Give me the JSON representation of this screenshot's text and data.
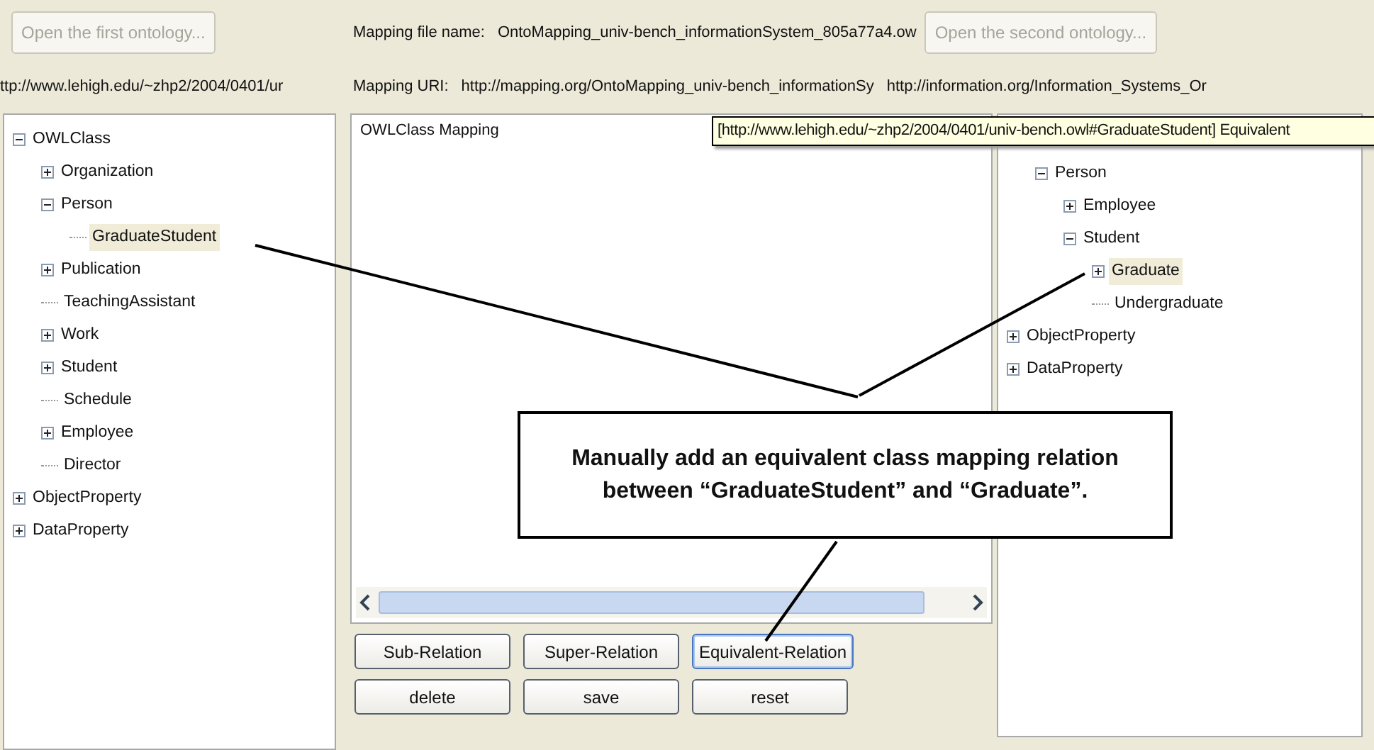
{
  "top_bar": {
    "open_first_button": {
      "label": "Open the first ontology...",
      "disabled": true
    },
    "mapping_file_label": "Mapping file name:",
    "mapping_file_name": "OntoMapping_univ-bench_informationSystem_805a77a4.ow",
    "open_second_button": {
      "label": "Open the second ontology...",
      "disabled": true
    }
  },
  "uri_bar": {
    "first_ontology_uri": "ttp://www.lehigh.edu/~zhp2/2004/0401/ur",
    "mapping_uri_label": "Mapping URI:",
    "mapping_uri": "http://mapping.org/OntoMapping_univ-bench_informationSy",
    "second_ontology_uri": "http://information.org/Information_Systems_Or"
  },
  "left_tree": [
    {
      "label": "OWLClass",
      "expanded": true,
      "selected": false,
      "children": [
        {
          "label": "Organization",
          "expanded": false,
          "selected": false
        },
        {
          "label": "Person",
          "expanded": true,
          "selected": false,
          "children": [
            {
              "label": "GraduateStudent",
              "selected": true
            }
          ]
        },
        {
          "label": "Publication",
          "expanded": false,
          "selected": false
        },
        {
          "label": "TeachingAssistant",
          "selected": false
        },
        {
          "label": "Work",
          "expanded": false,
          "selected": false
        },
        {
          "label": "Student",
          "expanded": false,
          "selected": false
        },
        {
          "label": "Schedule",
          "selected": false
        },
        {
          "label": "Employee",
          "expanded": false,
          "selected": false
        },
        {
          "label": "Director",
          "selected": false
        }
      ]
    },
    {
      "label": "ObjectProperty",
      "expanded": false,
      "selected": false
    },
    {
      "label": "DataProperty",
      "expanded": false,
      "selected": false
    }
  ],
  "mapping_panel": {
    "title": "OWLClass Mapping",
    "tooltip": "[http://www.lehigh.edu/~zhp2/2004/0401/univ-bench.owl#GraduateStudent] Equivalent"
  },
  "relation_buttons": [
    {
      "label": "Sub-Relation",
      "focused": false
    },
    {
      "label": "Super-Relation",
      "focused": false
    },
    {
      "label": "Equivalent-Relation",
      "focused": true
    }
  ],
  "action_buttons": [
    {
      "label": "delete",
      "focused": false
    },
    {
      "label": "save",
      "focused": false
    },
    {
      "label": "reset",
      "focused": false
    }
  ],
  "right_tree": {
    "branch_under_tooltip": [
      {
        "label": "Person",
        "expanded": true,
        "selected": false,
        "children": [
          {
            "label": "Employee",
            "expanded": false,
            "selected": false
          },
          {
            "label": "Student",
            "expanded": true,
            "selected": false,
            "children": [
              {
                "label": "Graduate",
                "expanded": false,
                "selected": true
              },
              {
                "label": "Undergraduate",
                "selected": false
              }
            ]
          }
        ]
      }
    ],
    "items": [
      {
        "label": "ObjectProperty",
        "expanded": false,
        "selected": false
      },
      {
        "label": "DataProperty",
        "expanded": false,
        "selected": false
      }
    ]
  },
  "callout": {
    "text": "Manually add an equivalent class mapping relation between “GraduateStudent” and “Graduate”."
  }
}
